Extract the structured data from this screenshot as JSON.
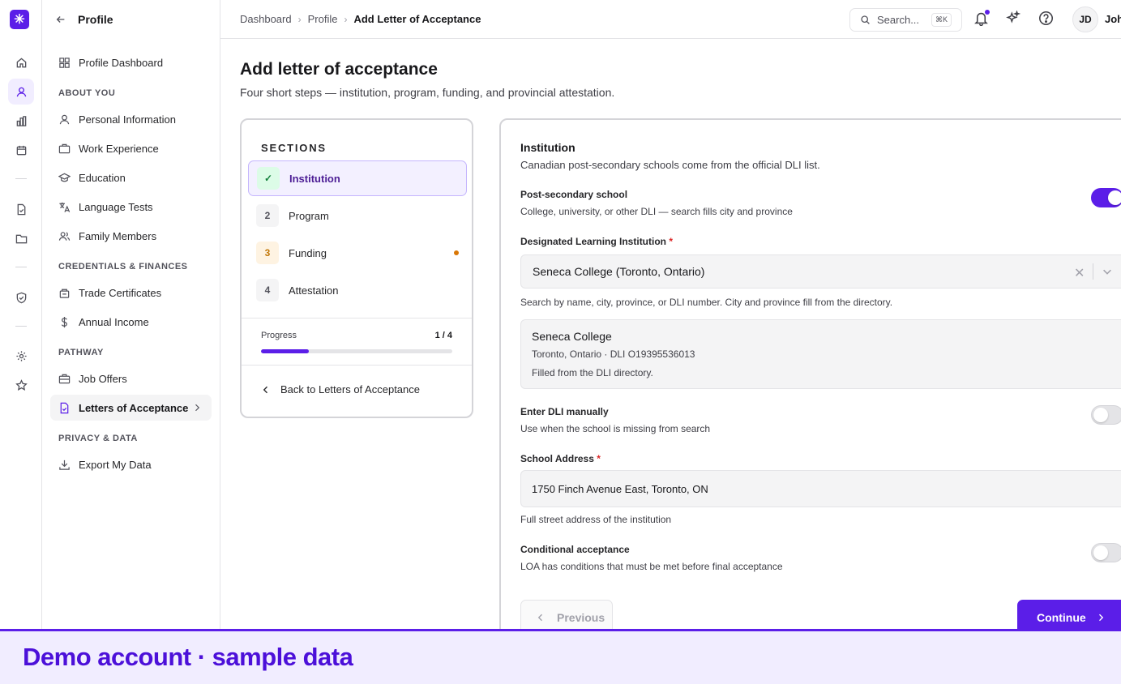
{
  "app": {
    "logo_icon": "asterisk-logo-icon",
    "accent_color": "#5b1ee8"
  },
  "rail": {
    "icons": [
      "home-icon",
      "user-icon",
      "chart-icon",
      "calendar-icon",
      "file-check-icon",
      "folder-icon",
      "shield-check-icon",
      "gear-icon",
      "star-icon"
    ],
    "active": "user-icon"
  },
  "sidebar": {
    "title": "Profile",
    "dashboard_label": "Profile Dashboard",
    "sections": [
      {
        "heading": "ABOUT YOU",
        "items": [
          "Personal Information",
          "Work Experience",
          "Education",
          "Language Tests",
          "Family Members"
        ]
      },
      {
        "heading": "CREDENTIALS & FINANCES",
        "items": [
          "Trade Certificates",
          "Annual Income"
        ]
      },
      {
        "heading": "PATHWAY",
        "items": [
          "Job Offers",
          "Letters of Acceptance"
        ]
      },
      {
        "heading": "PRIVACY & DATA",
        "items": [
          "Export My Data"
        ]
      }
    ],
    "active_item": "Letters of Acceptance"
  },
  "topbar": {
    "breadcrumbs": [
      "Dashboard",
      "Profile",
      "Add Letter of Acceptance"
    ],
    "search_placeholder": "Search...",
    "search_shortcut": "⌘K",
    "avatar_initials": "JD",
    "user_name": "Joh"
  },
  "page": {
    "title": "Add letter of acceptance",
    "subtitle": "Four short steps — institution, program, funding, and provincial attestation."
  },
  "sections_card": {
    "heading": "SECTIONS",
    "steps": [
      {
        "num": "✓",
        "label": "Institution",
        "state": "complete"
      },
      {
        "num": "2",
        "label": "Program",
        "state": "default"
      },
      {
        "num": "3",
        "label": "Funding",
        "state": "warning"
      },
      {
        "num": "4",
        "label": "Attestation",
        "state": "default"
      }
    ],
    "progress_label": "Progress",
    "progress_count": "1 / 4",
    "progress_fraction": 0.25,
    "back_label": "Back to Letters of Acceptance"
  },
  "form": {
    "heading": "Institution",
    "intro": "Canadian post-secondary schools come from the official DLI list.",
    "post_secondary": {
      "label": "Post-secondary school",
      "desc": "College, university, or other DLI — search fills city and province",
      "on": true
    },
    "dli": {
      "label": "Designated Learning Institution",
      "required_mark": "*",
      "value": "Seneca College (Toronto, Ontario)",
      "help": "Search by name, city, province, or DLI number. City and province fill from the directory."
    },
    "dli_info": {
      "name": "Seneca College",
      "location": "Toronto, Ontario · DLI O19395536013",
      "note": "Filled from the DLI directory."
    },
    "manual_dli": {
      "label": "Enter DLI manually",
      "desc": "Use when the school is missing from search",
      "on": false
    },
    "address": {
      "label": "School Address",
      "required_mark": "*",
      "value": "1750 Finch Avenue East, Toronto, ON",
      "help": "Full street address of the institution"
    },
    "conditional": {
      "label": "Conditional acceptance",
      "desc": "LOA has conditions that must be met before final acceptance",
      "on": false
    },
    "prev_label": "Previous",
    "next_label": "Continue"
  },
  "banner": {
    "text": "Demo account · sample data"
  }
}
